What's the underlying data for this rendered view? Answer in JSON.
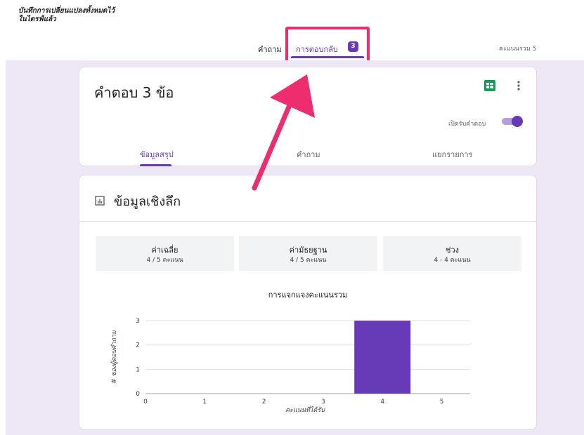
{
  "header": {
    "saved_line1": "บันทึกการเปลี่ยนแปลงทั้งหมดไว้",
    "saved_line2": "ในไดรฟ์แล้ว",
    "tab_questions": "คำถาม",
    "tab_responses": "การตอบกลับ",
    "responses_count": "3",
    "total_points": "คะแนนรวม 5"
  },
  "summary_card": {
    "title": "คำตอบ 3 ข้อ",
    "accept_responses_label": "เปิดรับคำตอบ",
    "accept_responses_on": true,
    "tabs": [
      {
        "label": "ข้อมูลสรุป",
        "active": true
      },
      {
        "label": "คำถาม",
        "active": false
      },
      {
        "label": "แยกรายการ",
        "active": false
      }
    ]
  },
  "insights": {
    "title": "ข้อมูลเชิงลึก",
    "stats": [
      {
        "label": "ค่าเฉลี่ย",
        "value": "4 / 5 คะแนน"
      },
      {
        "label": "ค่ามัธยฐาน",
        "value": "4 / 5 คะแนน"
      },
      {
        "label": "ช่วง",
        "value": "4 - 4 คะแนน"
      }
    ]
  },
  "chart_data": {
    "type": "bar",
    "title": "การแจกแจงคะแนนรวม",
    "xlabel": "คะแนนที่ได้รับ",
    "ylabel": "# ของผู้ตอบคำถาม",
    "categories": [
      "0",
      "1",
      "2",
      "3",
      "4",
      "5"
    ],
    "values": [
      0,
      0,
      0,
      0,
      3,
      0
    ],
    "ylim": [
      0,
      3
    ],
    "yticks": [
      "0",
      "1",
      "2",
      "3"
    ],
    "bar_color": "#673ab7",
    "grid": true
  },
  "colors": {
    "accent": "#673ab7",
    "background": "#ede7f6",
    "highlight": "#ee2d6e"
  }
}
